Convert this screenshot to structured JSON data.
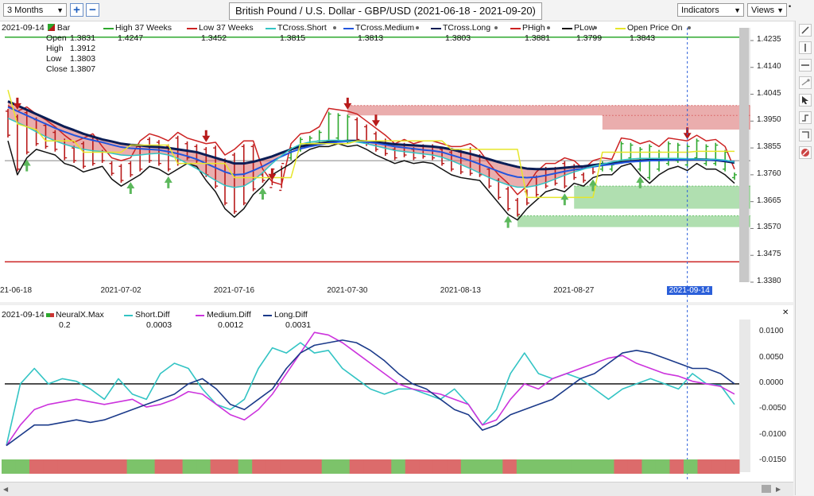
{
  "toolbar": {
    "period": "3 Months",
    "zoom_in": "+",
    "zoom_out": "−",
    "title": "British Pound / U.S. Dollar - GBP/USD (2021-06-18 - 2021-09-20)",
    "indicators": "Indicators",
    "views": "Views"
  },
  "legend_top": {
    "date": "2021-09-14",
    "bar_label": "Bar",
    "ohlc": [
      {
        "k": "Open",
        "v": "1.3831"
      },
      {
        "k": "High",
        "v": "1.3912"
      },
      {
        "k": "Low",
        "v": "1.3803"
      },
      {
        "k": "Close",
        "v": "1.3807"
      }
    ],
    "items": [
      {
        "name": "High 37 Weeks",
        "value": "1.4247",
        "color": "#2ea82e"
      },
      {
        "name": "Low 37 Weeks",
        "value": "1.3452",
        "color": "#cc2222"
      },
      {
        "name": "TCross.Short",
        "value": "1.3815",
        "color": "#33c4c4"
      },
      {
        "name": "TCross.Medium",
        "value": "1.3813",
        "color": "#2255dd"
      },
      {
        "name": "TCross.Long",
        "value": "1.3803",
        "color": "#0b1d55"
      },
      {
        "name": "PHigh",
        "value": "1.3881",
        "color": "#cc2222"
      },
      {
        "name": "PLow",
        "value": "1.3799",
        "color": "#111111"
      },
      {
        "name": "Open Price On",
        "value": "1.3843",
        "color": "#e6e62a"
      }
    ]
  },
  "legend_bottom": {
    "date": "2021-09-14",
    "items": [
      {
        "name": "NeuralX.Max",
        "value": "0.2",
        "color": "#cc3333"
      },
      {
        "name": "Short.Diff",
        "value": "0.0003",
        "color": "#33c4c4"
      },
      {
        "name": "Medium.Diff",
        "value": "0.0012",
        "color": "#cc33dd"
      },
      {
        "name": "Long.Diff",
        "value": "0.0031",
        "color": "#1b3a8a"
      }
    ]
  },
  "colors": {
    "green_line": "#2ea82e",
    "red_line": "#cc2222",
    "bull": "#2ea82e",
    "bear": "#b81a1a",
    "cyan": "#33c4c4",
    "blue": "#2255dd",
    "navy": "#0b1d55",
    "yellow": "#e6e62a",
    "magenta": "#cc33dd",
    "darkblue": "#1b3a8a",
    "band_red": "#d96a6a",
    "band_green": "#6fc46f",
    "highlight": "#2b5fd9"
  },
  "chart_data": [
    {
      "type": "line",
      "title": "British Pound / U.S. Dollar - GBP/USD (2021-06-18 - 2021-09-20)",
      "x_tick_labels": [
        "21-06-18",
        "2021-07-02",
        "2021-07-16",
        "2021-07-30",
        "2021-08-13",
        "2021-08-27",
        "2021-09-14"
      ],
      "highlight_x": "2021-09-14",
      "y_tick_labels": [
        "1.4235",
        "1.4140",
        "1.4045",
        "1.3950",
        "1.3855",
        "1.3760",
        "1.3665",
        "1.3570",
        "1.3475",
        "1.3380"
      ],
      "ylim": [
        1.338,
        1.428
      ],
      "high_37_weeks": 1.4247,
      "low_37_weeks": 1.3452,
      "series": [
        {
          "name": "PHigh",
          "color": "#cc2222",
          "values": [
            1.4005,
            1.3985,
            1.4,
            1.3975,
            1.3955,
            1.393,
            1.39,
            1.3875,
            1.389,
            1.3905,
            1.386,
            1.382,
            1.381,
            1.382,
            1.388,
            1.3905,
            1.3895,
            1.388,
            1.391,
            1.389,
            1.388,
            1.387,
            1.3875,
            1.383,
            1.385,
            1.388,
            1.388,
            1.378,
            1.3735,
            1.3725,
            1.387,
            1.3905,
            1.391,
            1.393,
            1.3995,
            1.399,
            1.3985,
            1.3975,
            1.395,
            1.3925,
            1.39,
            1.387,
            1.3885,
            1.387,
            1.388,
            1.388,
            1.387,
            1.386,
            1.386,
            1.387,
            1.3845,
            1.38,
            1.376,
            1.373,
            1.369,
            1.372,
            1.377,
            1.38,
            1.38,
            1.382,
            1.381,
            1.378,
            1.381,
            1.382,
            1.3815,
            1.389,
            1.3885,
            1.387,
            1.388,
            1.386,
            1.389,
            1.3885,
            1.388,
            1.39,
            1.388,
            1.3885,
            1.386,
            1.378
          ]
        },
        {
          "name": "PLow",
          "color": "#111111",
          "values": [
            1.388,
            1.376,
            1.382,
            1.385,
            1.384,
            1.383,
            1.38,
            1.379,
            1.377,
            1.378,
            1.379,
            1.3745,
            1.372,
            1.374,
            1.376,
            1.379,
            1.378,
            1.376,
            1.378,
            1.38,
            1.379,
            1.374,
            1.37,
            1.364,
            1.361,
            1.364,
            1.369,
            1.372,
            1.376,
            1.378,
            1.38,
            1.383,
            1.385,
            1.386,
            1.386,
            1.387,
            1.386,
            1.3865,
            1.385,
            1.383,
            1.3815,
            1.38,
            1.381,
            1.38,
            1.3805,
            1.38,
            1.378,
            1.376,
            1.375,
            1.3745,
            1.374,
            1.37,
            1.366,
            1.362,
            1.36,
            1.364,
            1.367,
            1.37,
            1.371,
            1.37,
            1.373,
            1.372,
            1.375,
            1.376,
            1.376,
            1.379,
            1.38,
            1.376,
            1.373,
            1.376,
            1.378,
            1.379,
            1.3775,
            1.38,
            1.378,
            1.378,
            1.376,
            1.373
          ]
        },
        {
          "name": "TCross.Long",
          "color": "#0b1d55",
          "values": [
            1.402,
            1.4005,
            1.399,
            1.3975,
            1.396,
            1.3945,
            1.393,
            1.3918,
            1.3905,
            1.3895,
            1.3885,
            1.3878,
            1.387,
            1.3866,
            1.3864,
            1.386,
            1.3858,
            1.3855,
            1.385,
            1.3845,
            1.384,
            1.383,
            1.382,
            1.381,
            1.38,
            1.38,
            1.3806,
            1.3815,
            1.3825,
            1.3838,
            1.385,
            1.386,
            1.3866,
            1.387,
            1.3875,
            1.3878,
            1.388,
            1.388,
            1.3878,
            1.3875,
            1.3872,
            1.3868,
            1.3866,
            1.3864,
            1.3862,
            1.386,
            1.3856,
            1.385,
            1.3842,
            1.3834,
            1.3825,
            1.3815,
            1.3805,
            1.3796,
            1.3788,
            1.3782,
            1.378,
            1.378,
            1.3782,
            1.3785,
            1.3788,
            1.379,
            1.3794,
            1.3798,
            1.38,
            1.3804,
            1.3808,
            1.381,
            1.3812,
            1.3812,
            1.3813,
            1.3814,
            1.3814,
            1.3815,
            1.3814,
            1.3812,
            1.3808,
            1.3803
          ]
        },
        {
          "name": "TCross.Medium",
          "color": "#2255dd",
          "values": [
            1.4,
            1.3985,
            1.397,
            1.3955,
            1.394,
            1.3925,
            1.3912,
            1.39,
            1.389,
            1.3882,
            1.3875,
            1.3866,
            1.3858,
            1.3854,
            1.3852,
            1.385,
            1.3848,
            1.3842,
            1.3835,
            1.3826,
            1.3815,
            1.38,
            1.3785,
            1.377,
            1.376,
            1.3762,
            1.3775,
            1.379,
            1.3808,
            1.3825,
            1.384,
            1.3852,
            1.386,
            1.3866,
            1.3872,
            1.3876,
            1.3878,
            1.3878,
            1.3876,
            1.3872,
            1.3866,
            1.386,
            1.3856,
            1.3852,
            1.3848,
            1.3845,
            1.384,
            1.383,
            1.382,
            1.381,
            1.3798,
            1.3785,
            1.3772,
            1.376,
            1.3752,
            1.375,
            1.3752,
            1.3758,
            1.3765,
            1.3772,
            1.3778,
            1.3782,
            1.3788,
            1.3793,
            1.3797,
            1.3802,
            1.3806,
            1.3808,
            1.381,
            1.3811,
            1.3812,
            1.3813,
            1.3813,
            1.3814,
            1.3813,
            1.3812,
            1.381,
            1.3806
          ]
        },
        {
          "name": "TCross.Short",
          "color": "#33c4c4",
          "values": [
            1.396,
            1.3945,
            1.393,
            1.3912,
            1.3895,
            1.388,
            1.3868,
            1.3858,
            1.385,
            1.3845,
            1.3842,
            1.3836,
            1.383,
            1.3828,
            1.383,
            1.3834,
            1.3836,
            1.383,
            1.3818,
            1.38,
            1.3782,
            1.376,
            1.374,
            1.3722,
            1.3715,
            1.372,
            1.374,
            1.3768,
            1.38,
            1.3828,
            1.3852,
            1.3868,
            1.3876,
            1.388,
            1.3882,
            1.3882,
            1.388,
            1.3876,
            1.387,
            1.3862,
            1.3854,
            1.3846,
            1.3842,
            1.3838,
            1.3834,
            1.383,
            1.3822,
            1.381,
            1.3796,
            1.3782,
            1.3766,
            1.375,
            1.3736,
            1.3724,
            1.3716,
            1.3716,
            1.3722,
            1.3732,
            1.3745,
            1.3758,
            1.377,
            1.378,
            1.379,
            1.3798,
            1.3805,
            1.3812,
            1.3816,
            1.3818,
            1.3818,
            1.3818,
            1.3818,
            1.3818,
            1.3817,
            1.3816,
            1.3815,
            1.3815,
            1.3812,
            1.3805
          ]
        },
        {
          "name": "Open Price On",
          "color": "#e6e62a",
          "values": [
            1.406,
            1.394,
            1.393,
            1.392,
            1.388,
            1.388,
            1.388,
            1.388,
            1.384,
            1.384,
            1.384,
            1.384,
            1.384,
            1.3865,
            1.3865,
            1.3865,
            1.3865,
            1.3865,
            1.38,
            1.38,
            1.38,
            1.38,
            1.38,
            1.38,
            1.375,
            1.375,
            1.375,
            1.375,
            1.375,
            1.375,
            1.375,
            1.387,
            1.387,
            1.387,
            1.387,
            1.387,
            1.387,
            1.388,
            1.388,
            1.388,
            1.388,
            1.388,
            1.388,
            1.388,
            1.388,
            1.388,
            1.388,
            1.385,
            1.385,
            1.385,
            1.385,
            1.385,
            1.385,
            1.385,
            1.385,
            1.368,
            1.368,
            1.368,
            1.368,
            1.368,
            1.368,
            1.368,
            1.368,
            1.384,
            1.384,
            1.384,
            1.384,
            1.384,
            1.384,
            1.384,
            1.384,
            1.384,
            1.384,
            1.3843,
            1.3843,
            1.3843,
            1.3843,
            1.3843
          ]
        }
      ],
      "bands": [
        {
          "color": "red",
          "from": 1.397,
          "to": 1.4005,
          "x_start_index": 36
        },
        {
          "color": "red",
          "from": 1.392,
          "to": 1.397,
          "x_start_index": 63
        },
        {
          "color": "green",
          "from": 1.3575,
          "to": 1.3615,
          "x_start_index": 54
        },
        {
          "color": "green",
          "from": 1.364,
          "to": 1.372,
          "x_start_index": 60
        }
      ],
      "down_arrows_index": [
        1,
        21,
        28,
        36,
        39,
        72
      ],
      "up_arrows_index": [
        2,
        13,
        17,
        27,
        53,
        59,
        62,
        67
      ]
    },
    {
      "type": "line",
      "y_tick_labels": [
        "0.0100",
        "0.0050",
        "0.0000",
        "-0.0050",
        "-0.0100",
        "-0.0150"
      ],
      "ylim": [
        -0.015,
        0.0125
      ],
      "series": [
        {
          "name": "Short.Diff",
          "color": "#33c4c4",
          "values": [
            -0.012,
            0.0,
            0.003,
            0.0,
            0.001,
            0.0005,
            -0.001,
            -0.003,
            0.001,
            -0.002,
            -0.003,
            0.002,
            0.004,
            0.003,
            -0.001,
            -0.004,
            -0.005,
            -0.003,
            0.003,
            0.007,
            0.006,
            0.008,
            0.006,
            0.0065,
            0.003,
            0.001,
            -0.001,
            -0.002,
            -0.001,
            -0.001,
            -0.002,
            -0.003,
            -0.001,
            -0.004,
            -0.008,
            -0.005,
            0.002,
            0.006,
            0.002,
            0.001,
            0.002,
            0.001,
            -0.001,
            -0.003,
            -0.001,
            0.0,
            0.001,
            0.0,
            -0.001,
            0.002,
            0.0,
            -0.0003,
            -0.004
          ]
        },
        {
          "name": "Medium.Diff",
          "color": "#cc33dd",
          "values": [
            -0.012,
            -0.008,
            -0.005,
            -0.004,
            -0.0035,
            -0.003,
            -0.0035,
            -0.004,
            -0.0035,
            -0.003,
            -0.0045,
            -0.004,
            -0.003,
            -0.0015,
            -0.002,
            -0.004,
            -0.006,
            -0.007,
            -0.005,
            -0.002,
            0.002,
            0.006,
            0.01,
            0.0095,
            0.008,
            0.006,
            0.004,
            0.002,
            0.0,
            -0.001,
            -0.0015,
            -0.002,
            -0.003,
            -0.004,
            -0.008,
            -0.007,
            -0.003,
            0.0,
            -0.001,
            0.001,
            0.002,
            0.003,
            0.004,
            0.005,
            0.0055,
            0.004,
            0.003,
            0.002,
            0.0015,
            0.0005,
            0.0,
            -0.0005,
            -0.002
          ]
        },
        {
          "name": "Long.Diff",
          "color": "#1b3a8a",
          "values": [
            -0.012,
            -0.01,
            -0.008,
            -0.008,
            -0.0075,
            -0.007,
            -0.0075,
            -0.007,
            -0.006,
            -0.005,
            -0.004,
            -0.003,
            -0.002,
            0.0,
            0.001,
            -0.001,
            -0.004,
            -0.005,
            -0.003,
            -0.001,
            0.003,
            0.006,
            0.0075,
            0.008,
            0.0085,
            0.008,
            0.0065,
            0.0045,
            0.002,
            0.0,
            -0.001,
            -0.003,
            -0.005,
            -0.006,
            -0.009,
            -0.008,
            -0.006,
            -0.005,
            -0.004,
            -0.003,
            -0.001,
            0.001,
            0.002,
            0.004,
            0.006,
            0.0065,
            0.006,
            0.005,
            0.004,
            0.003,
            0.003,
            0.002,
            0.0
          ]
        }
      ],
      "neuralx_strip": [
        "g",
        "g",
        "r",
        "r",
        "r",
        "r",
        "r",
        "r",
        "r",
        "g",
        "g",
        "r",
        "r",
        "g",
        "g",
        "r",
        "r",
        "g",
        "r",
        "r",
        "r",
        "r",
        "r",
        "g",
        "g",
        "r",
        "r",
        "r",
        "g",
        "r",
        "r",
        "r",
        "r",
        "g",
        "g",
        "g",
        "r",
        "g",
        "g",
        "g",
        "g",
        "g",
        "g",
        "g",
        "r",
        "r",
        "g",
        "g",
        "r",
        "g",
        "r",
        "r",
        "r"
      ]
    }
  ]
}
